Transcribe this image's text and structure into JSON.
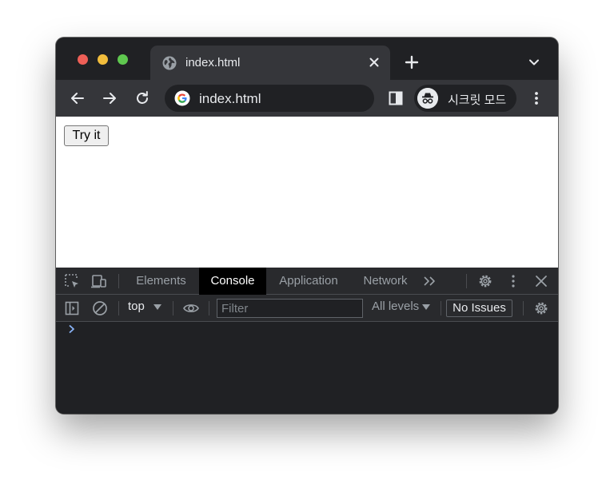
{
  "browser": {
    "tab": {
      "title": "index.html"
    },
    "omnibox": {
      "text": "index.html"
    },
    "profile": {
      "label": "시크릿 모드"
    }
  },
  "page": {
    "button_label": "Try it"
  },
  "devtools": {
    "tabs": [
      {
        "label": "Elements"
      },
      {
        "label": "Console"
      },
      {
        "label": "Application"
      },
      {
        "label": "Network"
      }
    ],
    "active_tab": "Console",
    "context": "top",
    "filter_placeholder": "Filter",
    "levels": "All levels",
    "issues": "No Issues"
  },
  "icons": {
    "traffic_lights": [
      "red-close-light",
      "yellow-minimize-light",
      "green-zoom-light"
    ],
    "tab_favicon": "globe-icon",
    "toolbar": [
      "back-icon",
      "forward-icon",
      "reload-icon",
      "google-icon",
      "side-panel-icon",
      "incognito-icon",
      "menu-icon"
    ],
    "devtools": [
      "inspect-icon",
      "device-toolbar-icon",
      "more-tabs-icon",
      "settings-icon",
      "more-options-icon",
      "close-icon",
      "sidebar-icon",
      "clear-icon",
      "eye-icon",
      "console-prompt-icon"
    ]
  },
  "colors": {
    "window_frame": "#202124",
    "toolbar": "#35363a",
    "devtools_bg": "#202124",
    "active_tab_bg": "#000000",
    "prompt_accent": "#8ab4f8"
  }
}
